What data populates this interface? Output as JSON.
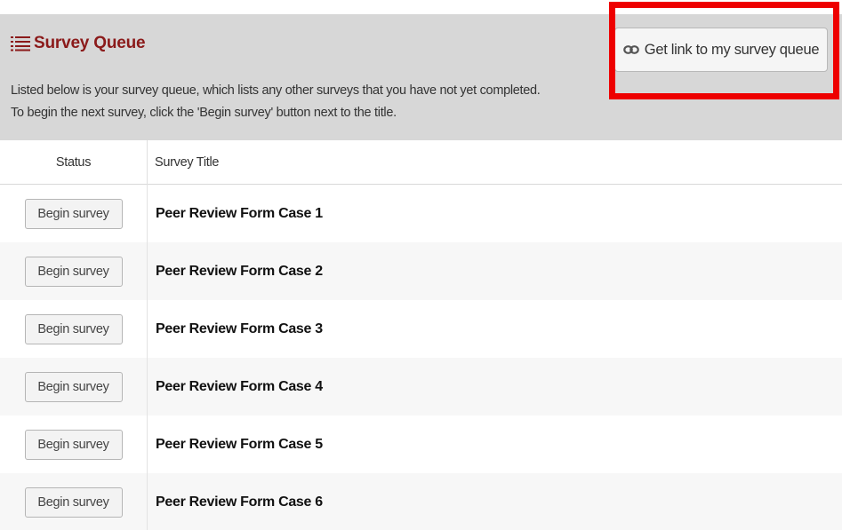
{
  "header": {
    "title": "Survey Queue",
    "description_line1": "Listed below is your survey queue, which lists any other surveys that you have not yet completed.",
    "description_line2": "To begin the next survey, click the 'Begin survey' button next to the title.",
    "link_button_label": "Get link to my survey queue",
    "title_icon": "list-icon",
    "link_icon": "link-icon"
  },
  "table": {
    "columns": [
      "Status",
      "Survey Title"
    ],
    "rows": [
      {
        "button": "Begin survey",
        "title": "Peer Review Form Case 1"
      },
      {
        "button": "Begin survey",
        "title": "Peer Review Form Case 2"
      },
      {
        "button": "Begin survey",
        "title": "Peer Review Form Case 3"
      },
      {
        "button": "Begin survey",
        "title": "Peer Review Form Case 4"
      },
      {
        "button": "Begin survey",
        "title": "Peer Review Form Case 5"
      },
      {
        "button": "Begin survey",
        "title": "Peer Review Form Case 6"
      }
    ]
  },
  "colors": {
    "title": "#8b1a1a",
    "header_bg": "#d7d7d7",
    "highlight": "#ee0000"
  }
}
